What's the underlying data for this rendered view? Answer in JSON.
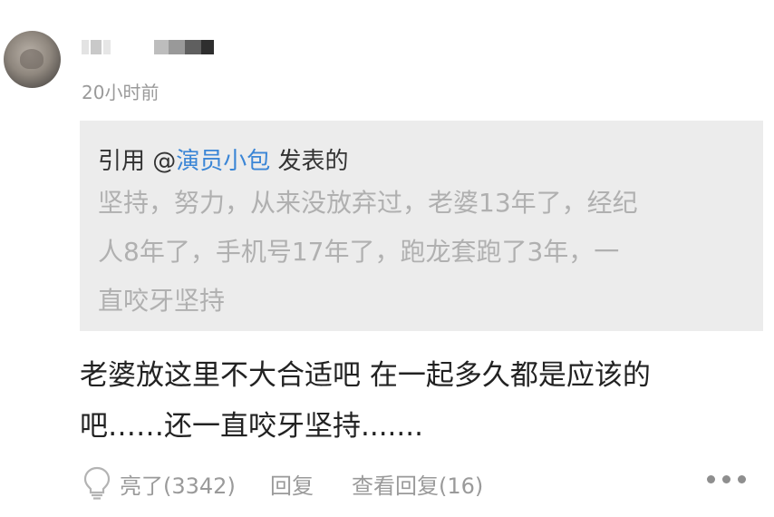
{
  "comment": {
    "timestamp": "20小时前",
    "quote": {
      "prefix": "引用 @",
      "mention": "演员小包",
      "suffix": " 发表的",
      "lines": [
        "坚持，努力，从来没放弃过，老婆13年了，经纪",
        "人8年了，手机号17年了，跑龙套跑了3年，一",
        "直咬牙坚持"
      ]
    },
    "body_lines": [
      "老婆放这里不大合适吧 在一起多久都是应该的",
      "吧……还一直咬牙坚持......."
    ],
    "actions": {
      "like_label": "亮了(3342)",
      "reply_label": "回复",
      "view_replies_label": "查看回复(16)"
    }
  },
  "colors": {
    "mention": "#3b86d6",
    "quote_text": "#b0b0b0",
    "quote_bg": "#ececec",
    "meta": "#9a9a9a"
  },
  "icons": [
    "lightbulb-icon",
    "more-dots-icon"
  ]
}
